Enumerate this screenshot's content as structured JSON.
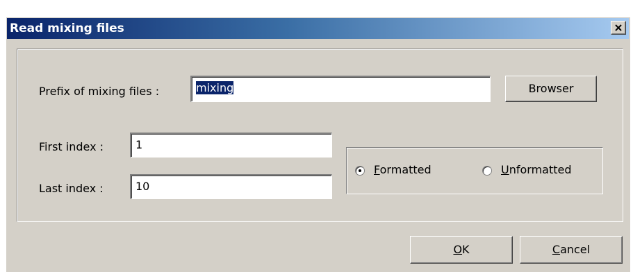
{
  "dialog": {
    "title": "Read mixing files",
    "close_label": "×"
  },
  "form": {
    "prefix_label": "Prefix of mixing files :",
    "prefix_value": "mixing",
    "browse_label": "Browser",
    "first_index_label": "First index :",
    "first_index_value": "1",
    "last_index_label": "Last index :",
    "last_index_value": "10"
  },
  "format": {
    "options": [
      {
        "label": "Formatted",
        "selected": true
      },
      {
        "label": "Unformatted",
        "selected": false
      }
    ]
  },
  "footer": {
    "ok_label": "OK",
    "cancel_label": "Cancel"
  },
  "colors": {
    "titlebar_start": "#0a246a",
    "titlebar_end": "#a6caf0",
    "dialog_bg": "#d4d0c8",
    "selection": "#0a246a"
  }
}
